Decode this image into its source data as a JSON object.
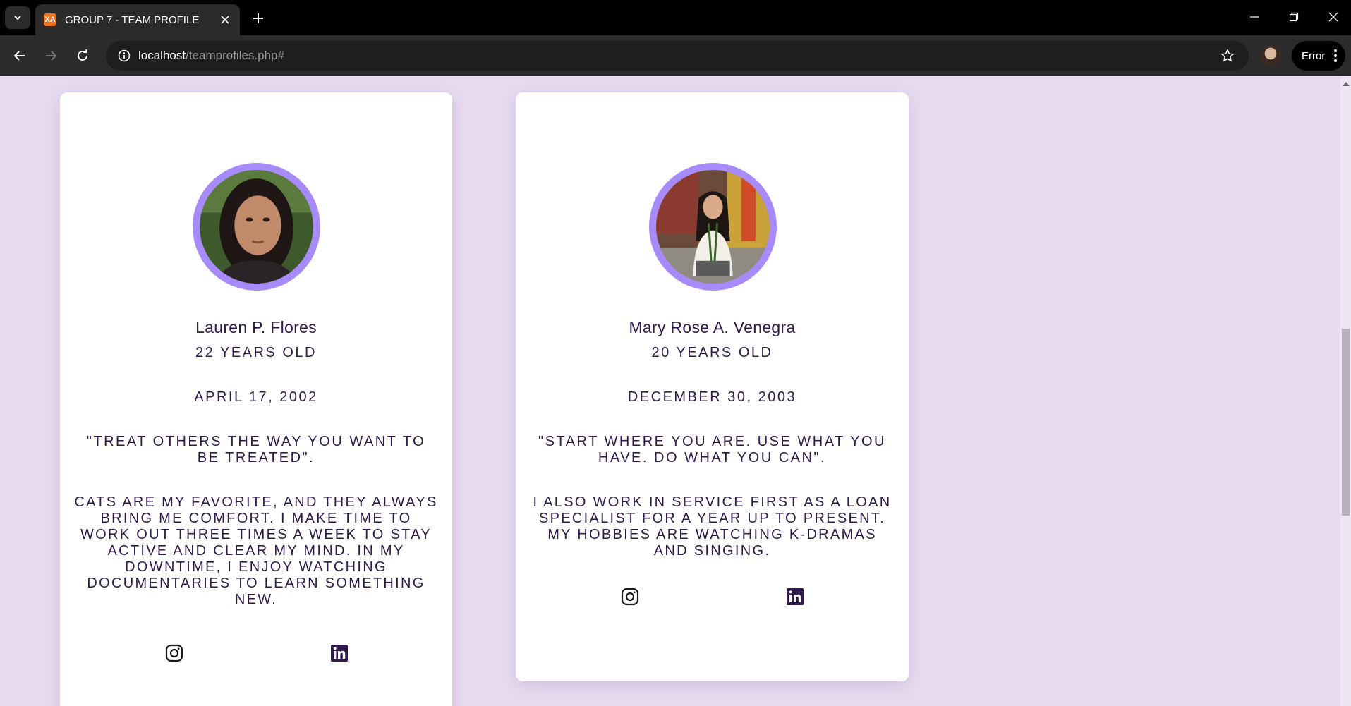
{
  "browser": {
    "tab_title": "GROUP 7 - TEAM PROFILE",
    "favicon_label": "XA",
    "url_host": "localhost",
    "url_path": "/teamprofiles.php#",
    "profile_status": "Error"
  },
  "profiles": [
    {
      "name": "Lauren P. Flores",
      "age": "22 YEARS OLD",
      "birthdate": "APRIL 17, 2002",
      "quote": "\"TREAT OTHERS THE WAY YOU WANT TO BE TREATED\".",
      "bio": "CATS ARE MY FAVORITE, AND THEY ALWAYS BRING ME COMFORT. I MAKE TIME TO WORK OUT THREE TIMES A WEEK TO STAY ACTIVE AND CLEAR MY MIND. IN MY DOWNTIME, I ENJOY WATCHING DOCUMENTARIES TO LEARN SOMETHING NEW.",
      "social": [
        "instagram-icon",
        "linkedin-icon"
      ]
    },
    {
      "name": "Mary Rose A. Venegra",
      "age": "20 YEARS OLD",
      "birthdate": "DECEMBER 30, 2003",
      "quote": "\"START WHERE YOU ARE. USE WHAT YOU HAVE. DO WHAT YOU CAN\".",
      "bio": "I ALSO WORK IN SERVICE FIRST AS A LOAN SPECIALIST FOR A YEAR UP TO PRESENT. MY HOBBIES ARE WATCHING K-DRAMAS AND SINGING.",
      "social": [
        "instagram-icon",
        "linkedin-icon"
      ]
    }
  ],
  "colors": {
    "page_background": "#e6dbef",
    "avatar_ring": "#a78bfa",
    "text": "#2f1a4a"
  }
}
